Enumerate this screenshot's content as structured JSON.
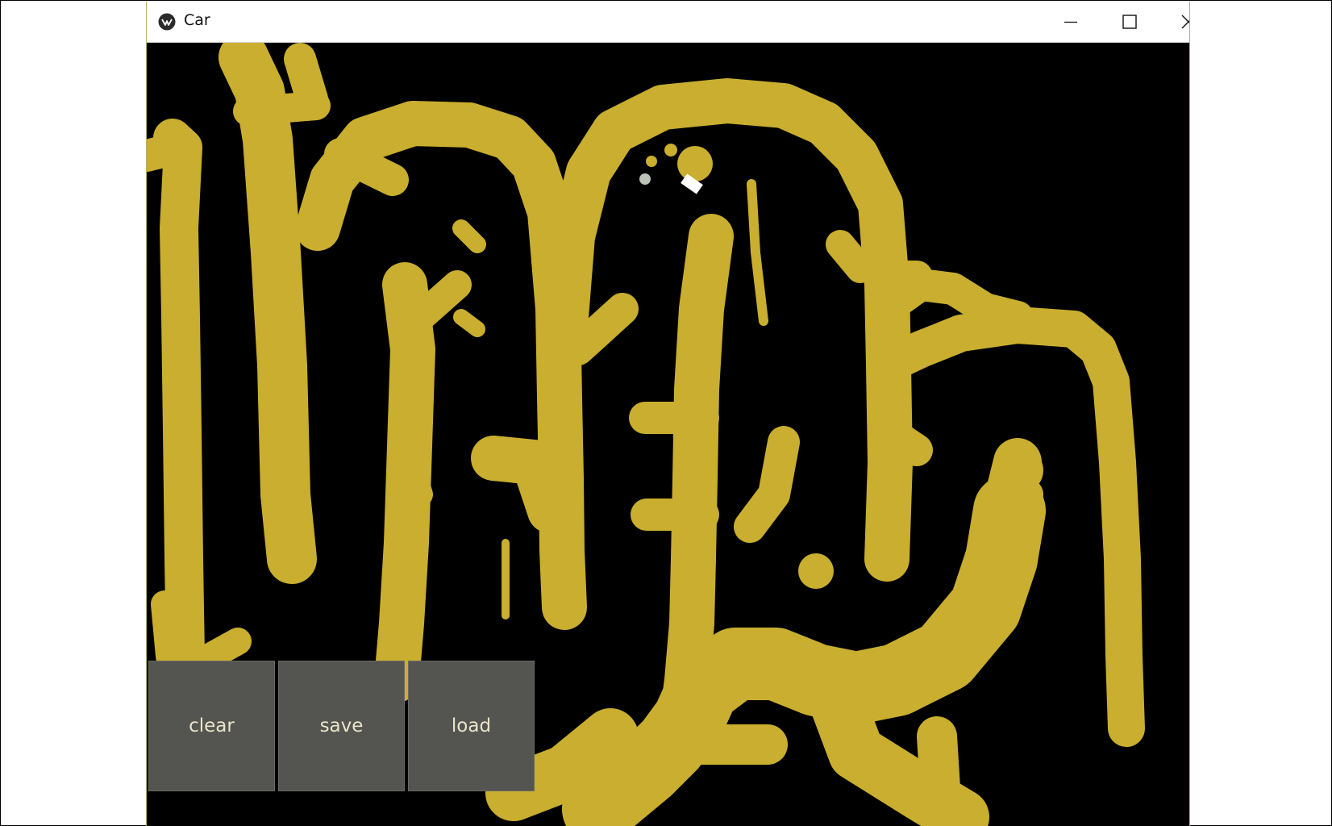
{
  "window": {
    "title": "Car",
    "controls": {
      "minimize": "minimize-icon",
      "maximize": "maximize-icon",
      "close": "close-icon"
    }
  },
  "canvas": {
    "background_color": "#000000",
    "sand_color": "#c9ae2f",
    "car_color": "#ffffff",
    "sensor_colors": [
      "#c9ae2f",
      "#c9ae2f",
      "#b9c3b6"
    ]
  },
  "toolbar": {
    "clear_label": "clear",
    "save_label": "save",
    "load_label": "load",
    "button_color": "#545451",
    "label_color": "#e9e4c9"
  }
}
